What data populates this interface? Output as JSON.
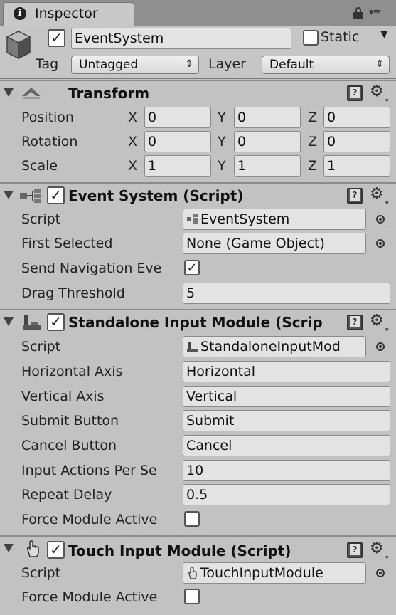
{
  "tab": {
    "label": "Inspector"
  },
  "object": {
    "name": "EventSystem",
    "active": true,
    "static_label": "Static",
    "static_checked": false,
    "tag_label": "Tag",
    "tag_value": "Untagged",
    "layer_label": "Layer",
    "layer_value": "Default"
  },
  "transform": {
    "title": "Transform",
    "rows": [
      {
        "label": "Position",
        "x": "0",
        "y": "0",
        "z": "0"
      },
      {
        "label": "Rotation",
        "x": "0",
        "y": "0",
        "z": "0"
      },
      {
        "label": "Scale",
        "x": "1",
        "y": "1",
        "z": "1"
      }
    ],
    "axis_x": "X",
    "axis_y": "Y",
    "axis_z": "Z"
  },
  "event_system": {
    "title": "Event System (Script)",
    "script_label": "Script",
    "script_value": "EventSystem",
    "first_selected_label": "First Selected",
    "first_selected_value": "None (Game Object)",
    "send_nav_label": "Send Navigation Eve",
    "send_nav_checked": true,
    "drag_threshold_label": "Drag Threshold",
    "drag_threshold_value": "5"
  },
  "standalone": {
    "title": "Standalone Input Module (Scrip",
    "script_label": "Script",
    "script_value": "StandaloneInputMod",
    "horizontal_label": "Horizontal Axis",
    "horizontal_value": "Horizontal",
    "vertical_label": "Vertical Axis",
    "vertical_value": "Vertical",
    "submit_label": "Submit Button",
    "submit_value": "Submit",
    "cancel_label": "Cancel Button",
    "cancel_value": "Cancel",
    "iaps_label": "Input Actions Per Se",
    "iaps_value": "10",
    "repeat_label": "Repeat Delay",
    "repeat_value": "0.5",
    "force_label": "Force Module Active",
    "force_checked": false
  },
  "touch": {
    "title": "Touch Input Module (Script)",
    "script_label": "Script",
    "script_value": "TouchInputModule",
    "force_label": "Force Module Active",
    "force_checked": false
  },
  "icons": {
    "tab": "info-icon",
    "lock": "lock-icon",
    "menu": "panel-menu-icon",
    "object": "cube-icon",
    "transform": "transform-icon",
    "event": "event-system-icon",
    "standalone": "joystick-icon",
    "touch": "hand-icon",
    "help": "help-book-icon",
    "settings": "gear-icon"
  },
  "colors": {
    "background": "#c2c2c2",
    "field": "#e3e3e3",
    "tabbar": "#8f8f8f"
  }
}
